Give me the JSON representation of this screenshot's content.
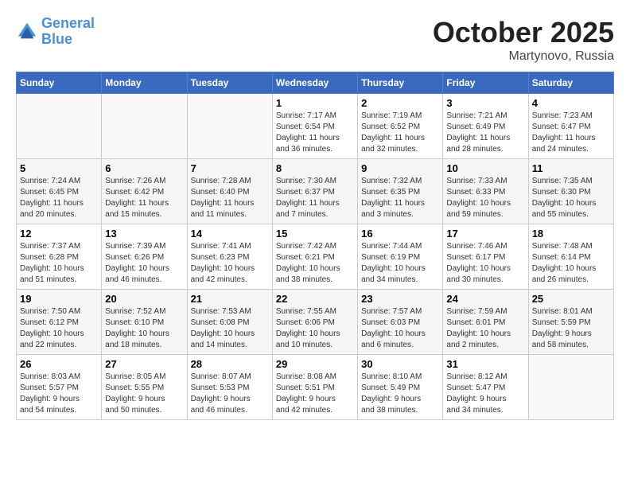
{
  "header": {
    "logo_line1": "General",
    "logo_line2": "Blue",
    "month_title": "October 2025",
    "location": "Martynovo, Russia"
  },
  "weekdays": [
    "Sunday",
    "Monday",
    "Tuesday",
    "Wednesday",
    "Thursday",
    "Friday",
    "Saturday"
  ],
  "weeks": [
    [
      {
        "day": "",
        "info": ""
      },
      {
        "day": "",
        "info": ""
      },
      {
        "day": "",
        "info": ""
      },
      {
        "day": "1",
        "info": "Sunrise: 7:17 AM\nSunset: 6:54 PM\nDaylight: 11 hours\nand 36 minutes."
      },
      {
        "day": "2",
        "info": "Sunrise: 7:19 AM\nSunset: 6:52 PM\nDaylight: 11 hours\nand 32 minutes."
      },
      {
        "day": "3",
        "info": "Sunrise: 7:21 AM\nSunset: 6:49 PM\nDaylight: 11 hours\nand 28 minutes."
      },
      {
        "day": "4",
        "info": "Sunrise: 7:23 AM\nSunset: 6:47 PM\nDaylight: 11 hours\nand 24 minutes."
      }
    ],
    [
      {
        "day": "5",
        "info": "Sunrise: 7:24 AM\nSunset: 6:45 PM\nDaylight: 11 hours\nand 20 minutes."
      },
      {
        "day": "6",
        "info": "Sunrise: 7:26 AM\nSunset: 6:42 PM\nDaylight: 11 hours\nand 15 minutes."
      },
      {
        "day": "7",
        "info": "Sunrise: 7:28 AM\nSunset: 6:40 PM\nDaylight: 11 hours\nand 11 minutes."
      },
      {
        "day": "8",
        "info": "Sunrise: 7:30 AM\nSunset: 6:37 PM\nDaylight: 11 hours\nand 7 minutes."
      },
      {
        "day": "9",
        "info": "Sunrise: 7:32 AM\nSunset: 6:35 PM\nDaylight: 11 hours\nand 3 minutes."
      },
      {
        "day": "10",
        "info": "Sunrise: 7:33 AM\nSunset: 6:33 PM\nDaylight: 10 hours\nand 59 minutes."
      },
      {
        "day": "11",
        "info": "Sunrise: 7:35 AM\nSunset: 6:30 PM\nDaylight: 10 hours\nand 55 minutes."
      }
    ],
    [
      {
        "day": "12",
        "info": "Sunrise: 7:37 AM\nSunset: 6:28 PM\nDaylight: 10 hours\nand 51 minutes."
      },
      {
        "day": "13",
        "info": "Sunrise: 7:39 AM\nSunset: 6:26 PM\nDaylight: 10 hours\nand 46 minutes."
      },
      {
        "day": "14",
        "info": "Sunrise: 7:41 AM\nSunset: 6:23 PM\nDaylight: 10 hours\nand 42 minutes."
      },
      {
        "day": "15",
        "info": "Sunrise: 7:42 AM\nSunset: 6:21 PM\nDaylight: 10 hours\nand 38 minutes."
      },
      {
        "day": "16",
        "info": "Sunrise: 7:44 AM\nSunset: 6:19 PM\nDaylight: 10 hours\nand 34 minutes."
      },
      {
        "day": "17",
        "info": "Sunrise: 7:46 AM\nSunset: 6:17 PM\nDaylight: 10 hours\nand 30 minutes."
      },
      {
        "day": "18",
        "info": "Sunrise: 7:48 AM\nSunset: 6:14 PM\nDaylight: 10 hours\nand 26 minutes."
      }
    ],
    [
      {
        "day": "19",
        "info": "Sunrise: 7:50 AM\nSunset: 6:12 PM\nDaylight: 10 hours\nand 22 minutes."
      },
      {
        "day": "20",
        "info": "Sunrise: 7:52 AM\nSunset: 6:10 PM\nDaylight: 10 hours\nand 18 minutes."
      },
      {
        "day": "21",
        "info": "Sunrise: 7:53 AM\nSunset: 6:08 PM\nDaylight: 10 hours\nand 14 minutes."
      },
      {
        "day": "22",
        "info": "Sunrise: 7:55 AM\nSunset: 6:06 PM\nDaylight: 10 hours\nand 10 minutes."
      },
      {
        "day": "23",
        "info": "Sunrise: 7:57 AM\nSunset: 6:03 PM\nDaylight: 10 hours\nand 6 minutes."
      },
      {
        "day": "24",
        "info": "Sunrise: 7:59 AM\nSunset: 6:01 PM\nDaylight: 10 hours\nand 2 minutes."
      },
      {
        "day": "25",
        "info": "Sunrise: 8:01 AM\nSunset: 5:59 PM\nDaylight: 9 hours\nand 58 minutes."
      }
    ],
    [
      {
        "day": "26",
        "info": "Sunrise: 8:03 AM\nSunset: 5:57 PM\nDaylight: 9 hours\nand 54 minutes."
      },
      {
        "day": "27",
        "info": "Sunrise: 8:05 AM\nSunset: 5:55 PM\nDaylight: 9 hours\nand 50 minutes."
      },
      {
        "day": "28",
        "info": "Sunrise: 8:07 AM\nSunset: 5:53 PM\nDaylight: 9 hours\nand 46 minutes."
      },
      {
        "day": "29",
        "info": "Sunrise: 8:08 AM\nSunset: 5:51 PM\nDaylight: 9 hours\nand 42 minutes."
      },
      {
        "day": "30",
        "info": "Sunrise: 8:10 AM\nSunset: 5:49 PM\nDaylight: 9 hours\nand 38 minutes."
      },
      {
        "day": "31",
        "info": "Sunrise: 8:12 AM\nSunset: 5:47 PM\nDaylight: 9 hours\nand 34 minutes."
      },
      {
        "day": "",
        "info": ""
      }
    ]
  ]
}
